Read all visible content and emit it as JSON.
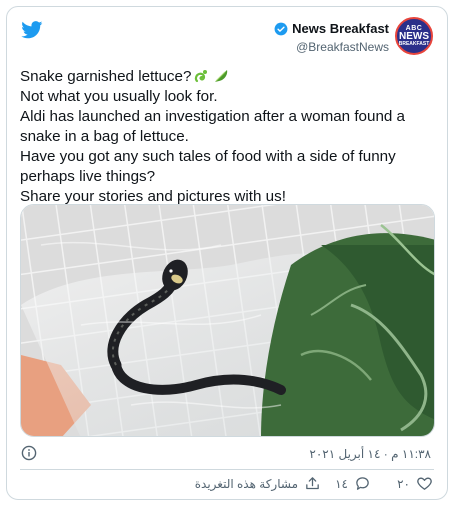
{
  "tweet": {
    "display_name": "News Breakfast",
    "handle": "@BreakfastNews",
    "avatar_text": [
      "ABC",
      "NEWS",
      "BREAKFAST"
    ],
    "lines": [
      "Snake garnished lettuce?",
      "Not what you usually look for.",
      "Aldi has launched an investigation after a woman found a",
      "snake in a bag of lettuce.",
      "Have you got any such tales of food with a side of funny",
      "perhaps live things?",
      "Share your stories and pictures with us!"
    ],
    "emojis": [
      "snake-icon",
      "leafy-green-icon"
    ],
    "timestamp": "١١:٣٨ م · ١٤ أبريل ٢٠٢١",
    "likes": "٢٠",
    "replies": "١٤",
    "share_label": "مشاركة هذه التغريدة"
  },
  "icons": {
    "brand": "twitter-bird-icon",
    "verified": "verified-badge-icon",
    "info": "info-icon",
    "like": "heart-icon",
    "reply": "reply-bubble-icon",
    "share": "share-icon"
  },
  "colors": {
    "twitter_blue": "#1d9bf0",
    "text": "#0f1419",
    "muted": "#536471",
    "border": "#cfd9de"
  }
}
